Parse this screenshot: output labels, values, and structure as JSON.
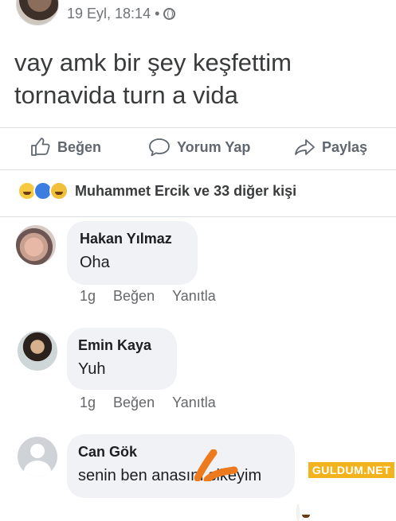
{
  "post": {
    "time": "19 Eyl, 18:14",
    "separator": "•",
    "text_lines": [
      "vay amk bir şey keşfettim",
      "tornavida turn a vida"
    ]
  },
  "actions": {
    "like": "Beğen",
    "comment": "Yorum Yap",
    "share": "Paylaş"
  },
  "reactions": {
    "summary": "Muhammet Ercik ve 33 diğer kişi"
  },
  "comments": [
    {
      "name": "Hakan Yılmaz",
      "text": "Oha",
      "time": "1g",
      "like": "Beğen",
      "reply": "Yanıtla"
    },
    {
      "name": "Emin Kaya",
      "text": "Yuh",
      "time": "1g",
      "like": "Beğen",
      "reply": "Yanıtla"
    },
    {
      "name": "Can Gök",
      "text": "senin ben anasını sikeyim"
    }
  ],
  "watermark": "GULDUM.NET",
  "colors": {
    "accent": "#f2b31d",
    "bubble": "#f0f2f5",
    "link_text": "#606770"
  }
}
